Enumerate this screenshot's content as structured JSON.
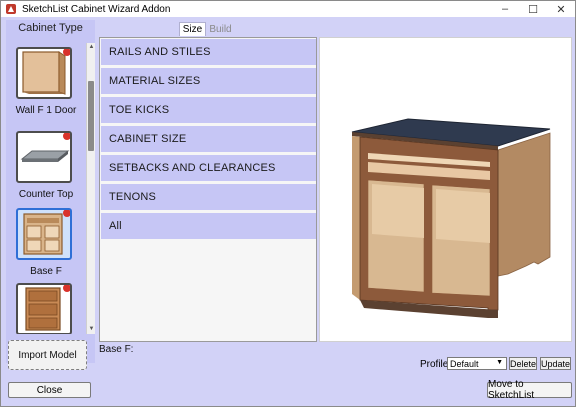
{
  "window": {
    "title": "SketchList Cabinet Wizard Addon",
    "minimize": "–",
    "maximize": "☐",
    "close": "✕"
  },
  "sidebar": {
    "header": "Cabinet Type",
    "items": [
      {
        "label": "Wall F 1 Door",
        "icon": "wall-cabinet-icon",
        "selected": false
      },
      {
        "label": "Counter Top",
        "icon": "counter-top-icon",
        "selected": false
      },
      {
        "label": "Base F",
        "icon": "base-cabinet-icon",
        "selected": true
      },
      {
        "label": "",
        "icon": "drawer-cabinet-icon",
        "selected": false
      }
    ],
    "import_button": "Import Model"
  },
  "tabs": [
    {
      "label": "Size",
      "active": true
    },
    {
      "label": "Build",
      "active": false
    }
  ],
  "accordion": {
    "items": [
      "RAILS AND STILES",
      "MATERIAL SIZES",
      "TOE KICKS",
      "CABINET SIZE",
      "SETBACKS AND CLEARANCES",
      "TENONS",
      "All"
    ]
  },
  "status": {
    "current_model": "Base F:"
  },
  "profile": {
    "label": "Profile:",
    "selected": "Default",
    "delete_label": "Delete",
    "update_label": "Update"
  },
  "footer": {
    "close_label": "Close",
    "move_label": "Move to SketchList"
  },
  "colors": {
    "panel_bg": "#d2d2f7",
    "accordion_item": "#c6c6f5",
    "selection_border": "#2f6fd6",
    "badge": "#d9322b"
  }
}
